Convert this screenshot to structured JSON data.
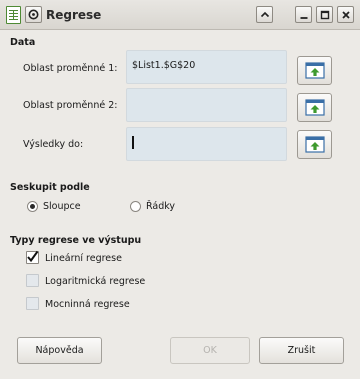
{
  "window": {
    "title": "Regrese"
  },
  "data_section": {
    "title": "Data",
    "var1_label": "Oblast proměnné 1:",
    "var1_value": "$List1.$G$20",
    "var2_label": "Oblast proměnné 2:",
    "var2_value": "",
    "output_label": "Výsledky do:",
    "output_value": ""
  },
  "group_by": {
    "title": "Seskupit podle",
    "columns_label": "Sloupce",
    "rows_label": "Řádky",
    "selected": "Sloupce"
  },
  "regression_types": {
    "title": "Typy regrese ve výstupu",
    "items": [
      {
        "label": "Lineární regrese",
        "checked": true
      },
      {
        "label": "Logaritmická regrese",
        "checked": false
      },
      {
        "label": "Mocninná regrese",
        "checked": false
      }
    ]
  },
  "buttons": {
    "help": "Nápověda",
    "ok": "OK",
    "cancel": "Zrušit"
  }
}
